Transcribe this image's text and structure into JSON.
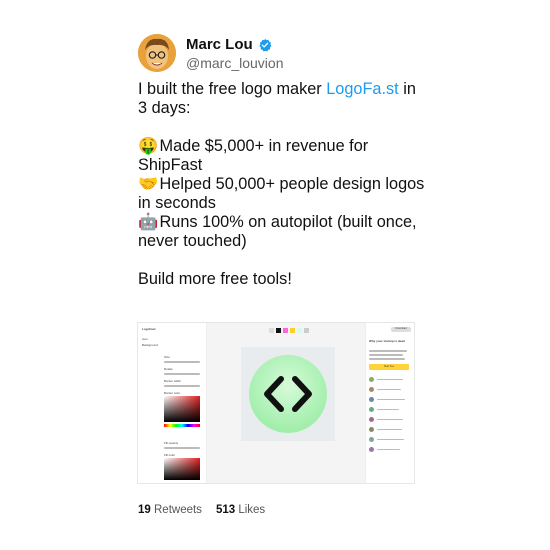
{
  "author": {
    "name": "Marc Lou",
    "handle": "@marc_louvion",
    "avatar_icon": "avatar-photo",
    "verified_icon": "verified-badge-icon",
    "verified_color": "#1d9bf0"
  },
  "tweet": {
    "intro_prefix": "I built the free logo maker ",
    "intro_link": "LogoFa.st",
    "intro_suffix": " in 3 days:",
    "bullets": [
      {
        "emoji": "🤑",
        "icon": "money-face-icon",
        "text": "Made $5,000+ in revenue for ShipFast"
      },
      {
        "emoji": "🤝",
        "icon": "handshake-icon",
        "text": "Helped 50,000+ people design logos in seconds"
      },
      {
        "emoji": "🤖",
        "icon": "robot-icon",
        "text": "Runs 100% on autopilot (built once, never touched)"
      }
    ],
    "closing": "Build more free tools!",
    "link_color": "#1d9bf0"
  },
  "screenshot": {
    "app_name": "LogoFast",
    "download_label": "Download",
    "logo_glyph": "<>",
    "logo_bg_color": "#a8f0b0",
    "sidebar_tabs": [
      "Icon",
      "Background"
    ],
    "sidebar_labels": [
      "Size",
      "Rotate",
      "Border width",
      "Border color",
      "Fill opacity",
      "Fill color"
    ],
    "right_title": "Why your startup is dead",
    "right_cta": "Start free",
    "right_cta_color": "#ffd43b"
  },
  "stats": {
    "retweets_count": "19",
    "retweets_label": "Retweets",
    "likes_count": "513",
    "likes_label": "Likes"
  }
}
